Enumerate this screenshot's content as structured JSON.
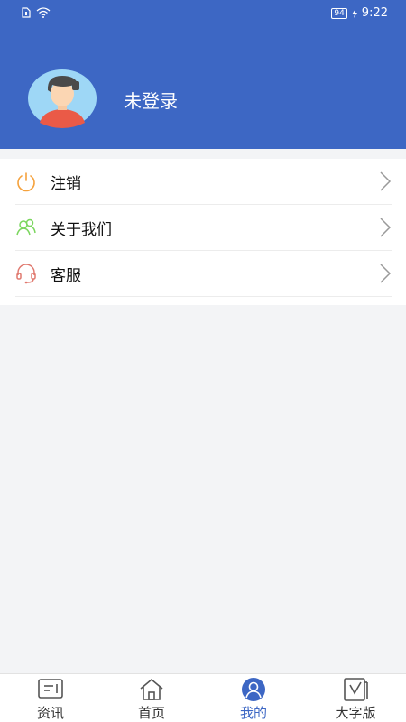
{
  "status_bar": {
    "battery": "94",
    "time": "9:22"
  },
  "profile": {
    "name": "未登录"
  },
  "menu": {
    "items": [
      {
        "label": "注销",
        "icon": "power-icon",
        "color": "#f5a23d"
      },
      {
        "label": "关于我们",
        "icon": "users-icon",
        "color": "#7bd65e"
      },
      {
        "label": "客服",
        "icon": "headset-icon",
        "color": "#e0796f"
      }
    ]
  },
  "tabbar": {
    "active_color": "#3d67c4",
    "tabs": [
      {
        "label": "资讯",
        "icon": "news-icon"
      },
      {
        "label": "首页",
        "icon": "home-icon"
      },
      {
        "label": "我的",
        "icon": "profile-icon",
        "active": true
      },
      {
        "label": "大字版",
        "icon": "large-text-icon"
      }
    ]
  }
}
